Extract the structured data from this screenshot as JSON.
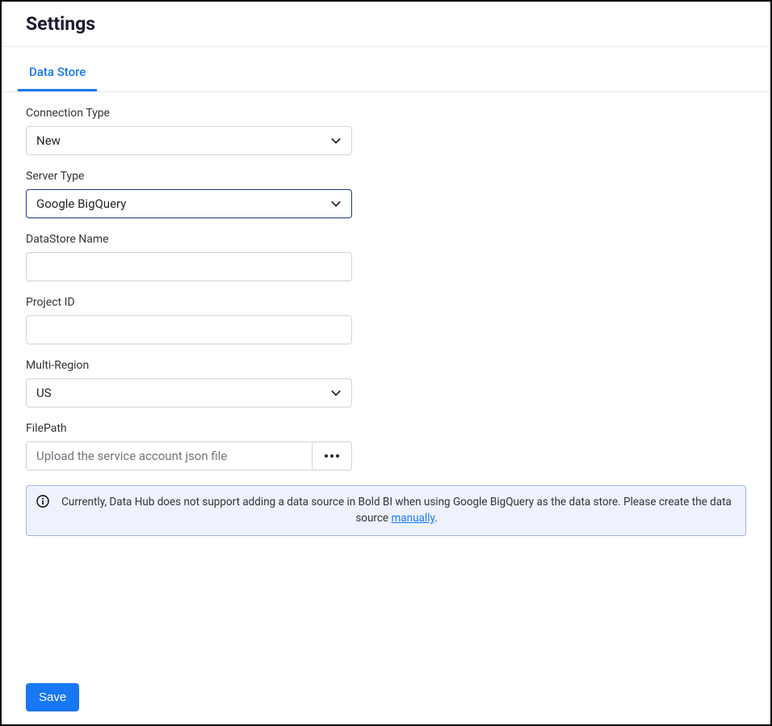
{
  "header": {
    "title": "Settings"
  },
  "tabs": {
    "active": "Data Store"
  },
  "form": {
    "connection_type": {
      "label": "Connection Type",
      "value": "New"
    },
    "server_type": {
      "label": "Server Type",
      "value": "Google BigQuery"
    },
    "datastore_name": {
      "label": "DataStore Name",
      "value": ""
    },
    "project_id": {
      "label": "Project ID",
      "value": ""
    },
    "multi_region": {
      "label": "Multi-Region",
      "value": "US"
    },
    "file_path": {
      "label": "FilePath",
      "placeholder": "Upload the service account json file"
    }
  },
  "info": {
    "text_before": "Currently, Data Hub does not support adding a data source in Bold BI when using Google BigQuery as the data store. Please create the data source ",
    "link_text": "manually",
    "text_after": "."
  },
  "footer": {
    "save_label": "Save"
  }
}
